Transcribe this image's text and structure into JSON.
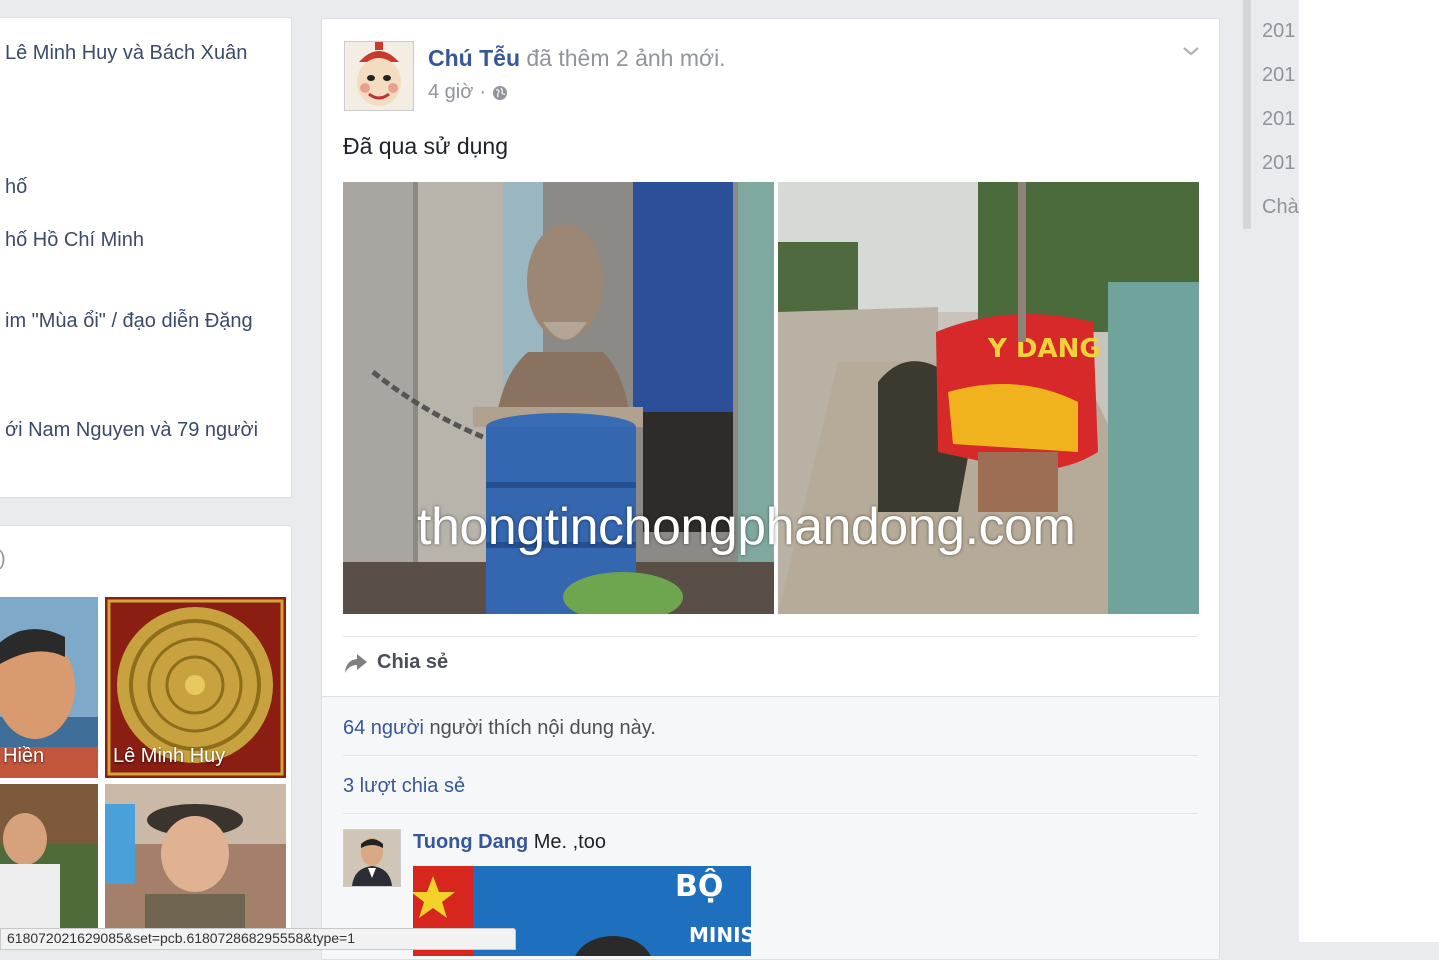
{
  "left_column": {
    "items": [
      "Lê Minh Huy và Bách Xuân",
      "hố",
      "hố Hồ Chí Minh",
      "im \"Mùa ổi\" / đạo diễn Đặng",
      "ới Nam Nguyen và 79 người"
    ],
    "photos_header": ")",
    "thumbs": [
      "Hiền",
      "Lê Minh Huy",
      "",
      ""
    ]
  },
  "post": {
    "author": "Chú Tễu",
    "action": "đã thêm 2 ảnh mới.",
    "time": "4 giờ",
    "separator": "·",
    "text": "Đã qua sử dụng",
    "watermark": "thongtinchongphandong.com",
    "share_label": "Chia sẻ",
    "likes_count": "64 người",
    "likes_rest": " người thích nội dung này.",
    "shares": "3 lượt chia sẻ",
    "comment": {
      "name": "Tuong Dang",
      "text": " Me. ,too",
      "image_text": "BỘ",
      "image_text2": "MINIS"
    },
    "banner_text": "Y DANG"
  },
  "sidebar": {
    "years": [
      "201",
      "201",
      "201",
      "201",
      "Chà"
    ]
  },
  "status_bar": {
    "url": "618072021629085&set=pcb.618072868295558&type=1"
  }
}
